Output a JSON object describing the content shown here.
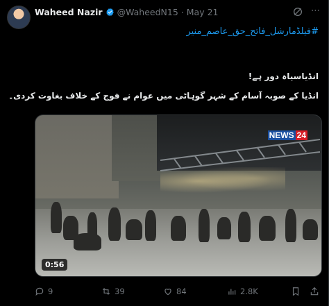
{
  "tweet": {
    "author_name": "Waheed Nazir",
    "handle": "@WaheedN15",
    "separator": "·",
    "date": "May 21",
    "hashtag": "#فیلڈمارشل_فاتح_حق_عاصم_منیر",
    "line1": "انڈیاسیاہ دور ہے!",
    "line2": "انڈیا کے صوبہ آسام کے شہر گوہاٹی میں عوام نے فوج کے خلاف بغاوت کردی۔"
  },
  "media": {
    "news_logo_part1": "NEWS",
    "news_logo_part2": "24",
    "duration": "0:56"
  },
  "actions": {
    "replies": "9",
    "retweets": "39",
    "likes": "84",
    "views": "2.8K"
  },
  "colors": {
    "background": "#000000",
    "text": "#e7e9ea",
    "muted": "#71767b",
    "accent": "#1d9bf0"
  },
  "icons": [
    "verified-icon",
    "grok-icon",
    "more-icon",
    "reply-icon",
    "retweet-icon",
    "like-icon",
    "views-icon",
    "bookmark-icon",
    "share-icon"
  ]
}
